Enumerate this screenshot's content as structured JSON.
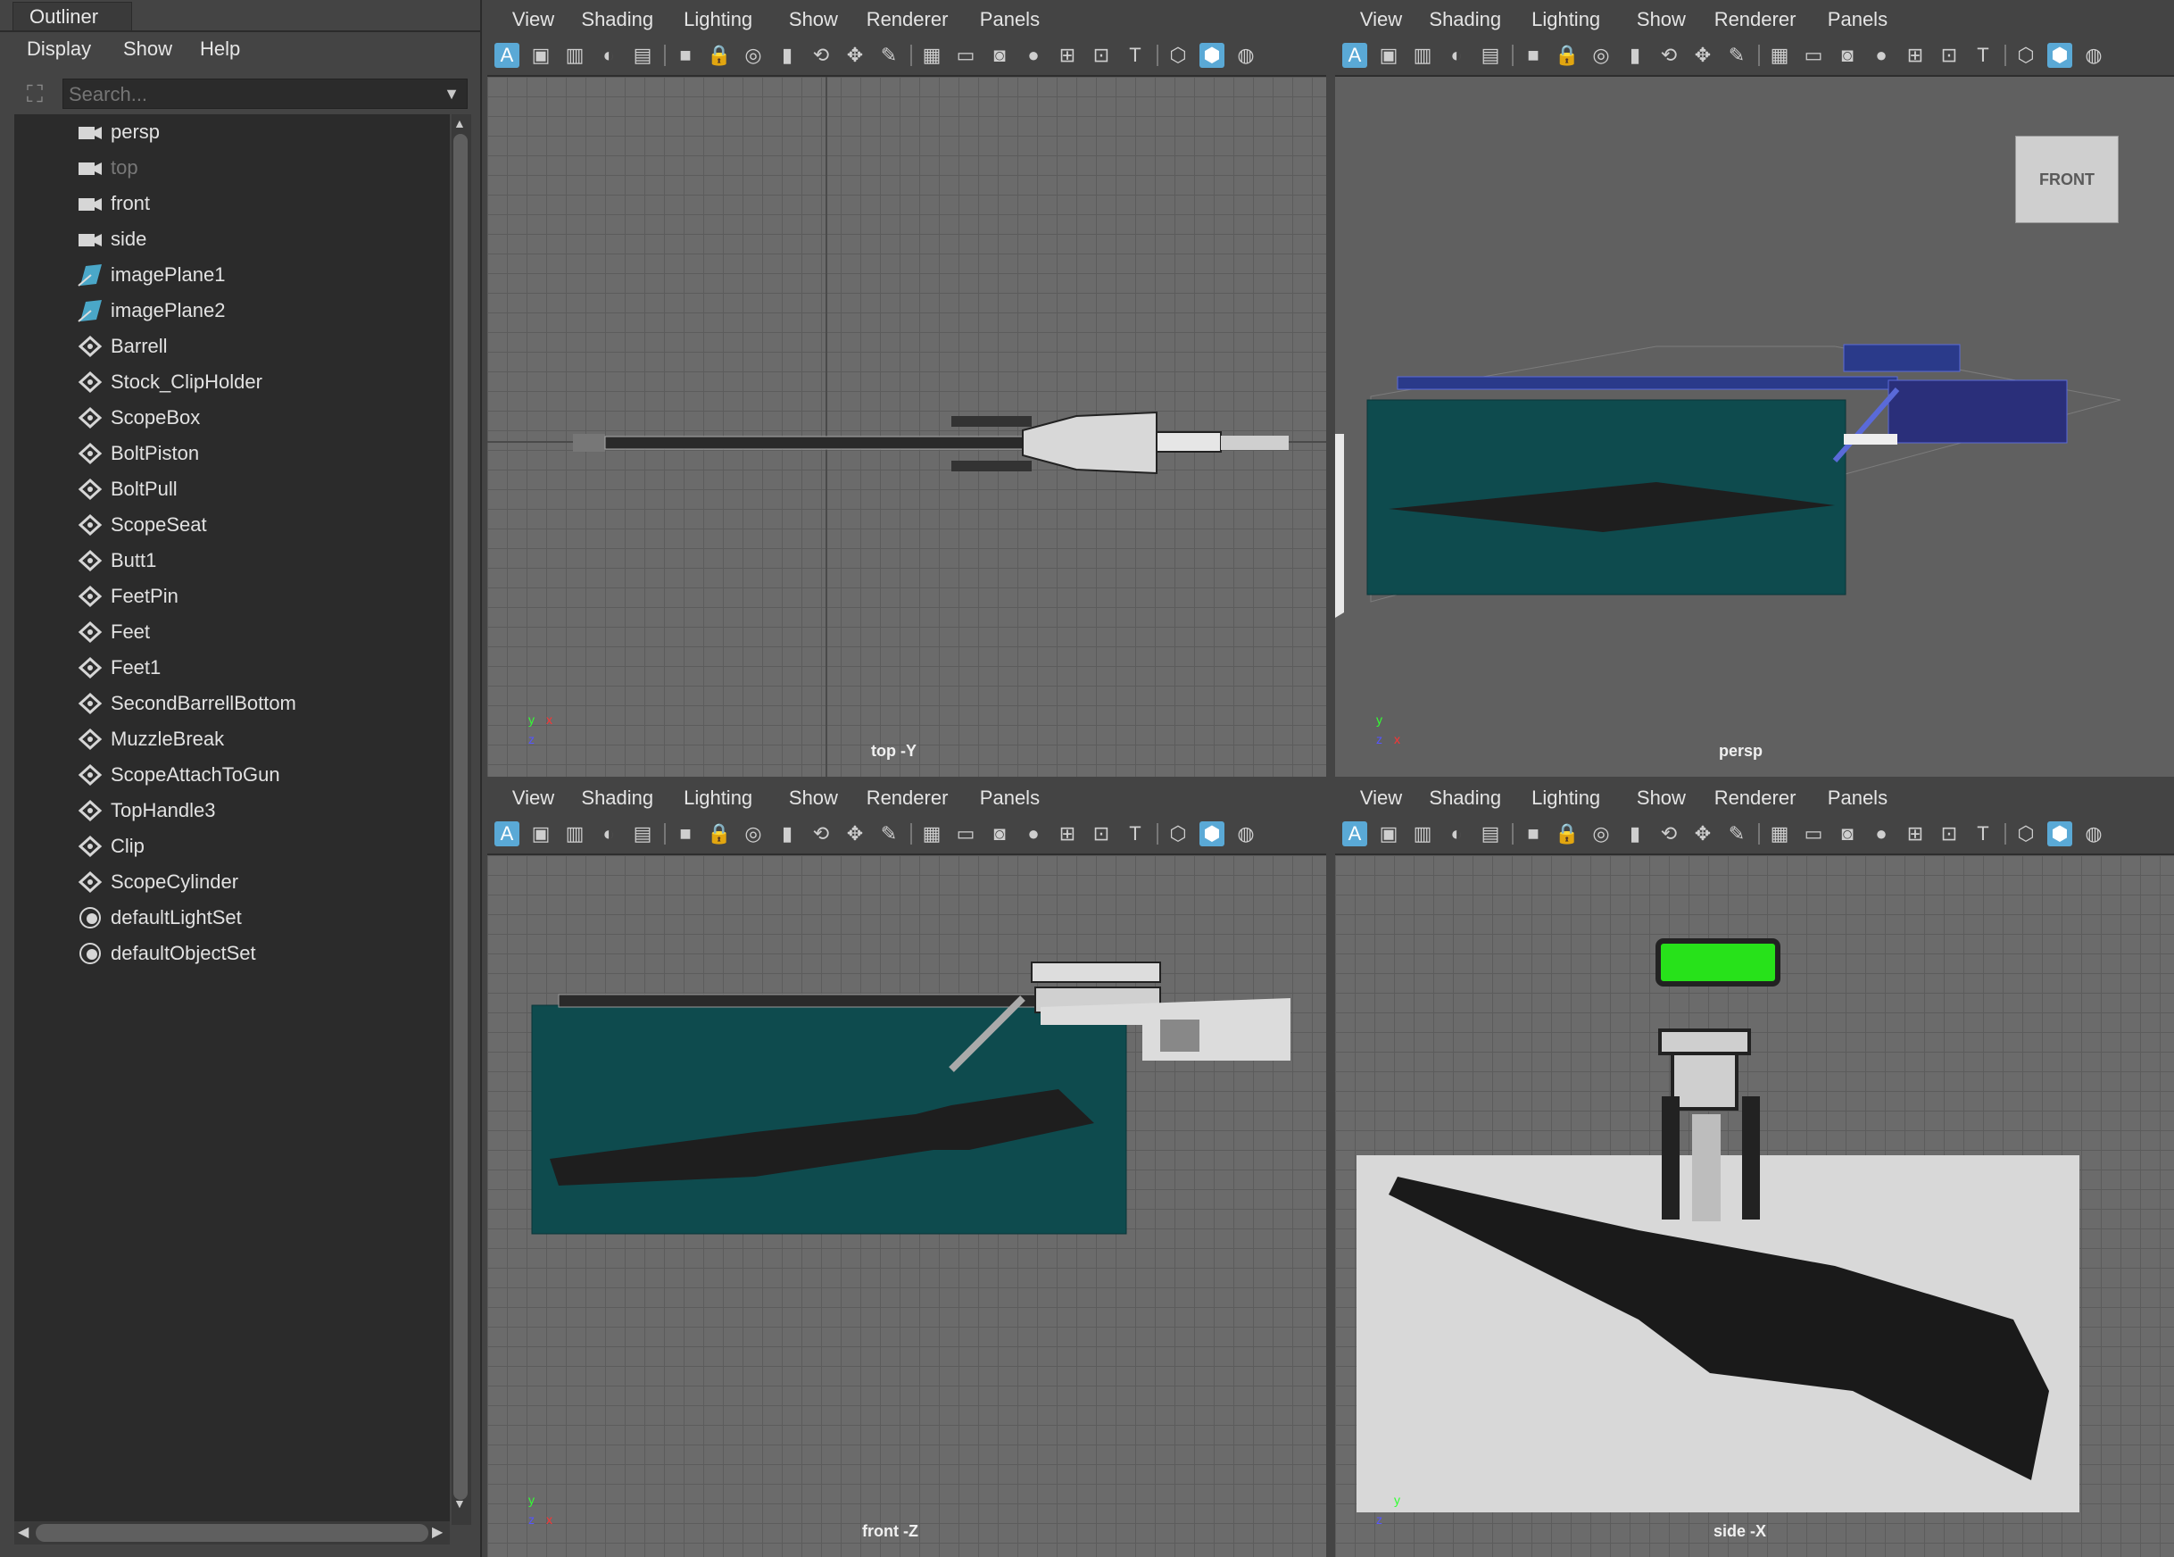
{
  "outliner": {
    "tab": "Outliner",
    "menu": [
      "Display",
      "Show",
      "Help"
    ],
    "search_placeholder": "Search...",
    "items": [
      {
        "label": "persp",
        "icon": "camera-icon",
        "dim": false
      },
      {
        "label": "top",
        "icon": "camera-icon",
        "dim": true
      },
      {
        "label": "front",
        "icon": "camera-icon",
        "dim": false
      },
      {
        "label": "side",
        "icon": "camera-icon",
        "dim": false
      },
      {
        "label": "imagePlane1",
        "icon": "image-plane-icon",
        "dim": false
      },
      {
        "label": "imagePlane2",
        "icon": "image-plane-icon",
        "dim": false
      },
      {
        "label": "Barrell",
        "icon": "transform-icon",
        "dim": false
      },
      {
        "label": "Stock_ClipHolder",
        "icon": "transform-icon",
        "dim": false
      },
      {
        "label": "ScopeBox",
        "icon": "transform-icon",
        "dim": false
      },
      {
        "label": "BoltPiston",
        "icon": "transform-icon",
        "dim": false
      },
      {
        "label": "BoltPull",
        "icon": "transform-icon",
        "dim": false
      },
      {
        "label": "ScopeSeat",
        "icon": "transform-icon",
        "dim": false
      },
      {
        "label": "Butt1",
        "icon": "transform-icon",
        "dim": false
      },
      {
        "label": "FeetPin",
        "icon": "transform-icon",
        "dim": false
      },
      {
        "label": "Feet",
        "icon": "transform-icon",
        "dim": false
      },
      {
        "label": "Feet1",
        "icon": "transform-icon",
        "dim": false
      },
      {
        "label": "SecondBarrellBottom",
        "icon": "transform-icon",
        "dim": false
      },
      {
        "label": "MuzzleBreak",
        "icon": "transform-icon",
        "dim": false
      },
      {
        "label": "ScopeAttachToGun",
        "icon": "transform-icon",
        "dim": false
      },
      {
        "label": "TopHandle3",
        "icon": "transform-icon",
        "dim": false
      },
      {
        "label": "Clip",
        "icon": "transform-icon",
        "dim": false
      },
      {
        "label": "ScopeCylinder",
        "icon": "transform-icon",
        "dim": false
      },
      {
        "label": "defaultLightSet",
        "icon": "set-icon",
        "dim": false
      },
      {
        "label": "defaultObjectSet",
        "icon": "set-icon",
        "dim": false
      }
    ]
  },
  "panel_menu": [
    "View",
    "Shading",
    "Lighting",
    "Show",
    "Renderer",
    "Panels"
  ],
  "toolbar_icons": [
    "select-camera-icon",
    "frame-icon",
    "image-plane-icon",
    "sphere-icon",
    "film-gate-icon",
    "camera-icon",
    "lock-camera-icon",
    "camera-attr-icon",
    "bookmark-icon",
    "tumble-icon",
    "track-icon",
    "paint-icon",
    "grid-icon",
    "safe-frame-icon",
    "resolution-gate-icon",
    "gate-mask-icon",
    "field-chart-icon",
    "safe-action-icon",
    "safe-title-icon",
    "wireframe-icon",
    "smooth-shade-icon",
    "textured-icon"
  ],
  "panels": {
    "top": {
      "camera": "top -Y"
    },
    "persp": {
      "camera": "persp",
      "viewcube": "FRONT"
    },
    "front": {
      "camera": "front -Z"
    },
    "side": {
      "camera": "side -X"
    }
  },
  "axis": {
    "x": "x",
    "y": "y",
    "z": "z"
  },
  "colors": {
    "selected_blue": "#5aa9d6",
    "teal_plane": "#0e4b4e",
    "green_scope": "#27e21a"
  }
}
